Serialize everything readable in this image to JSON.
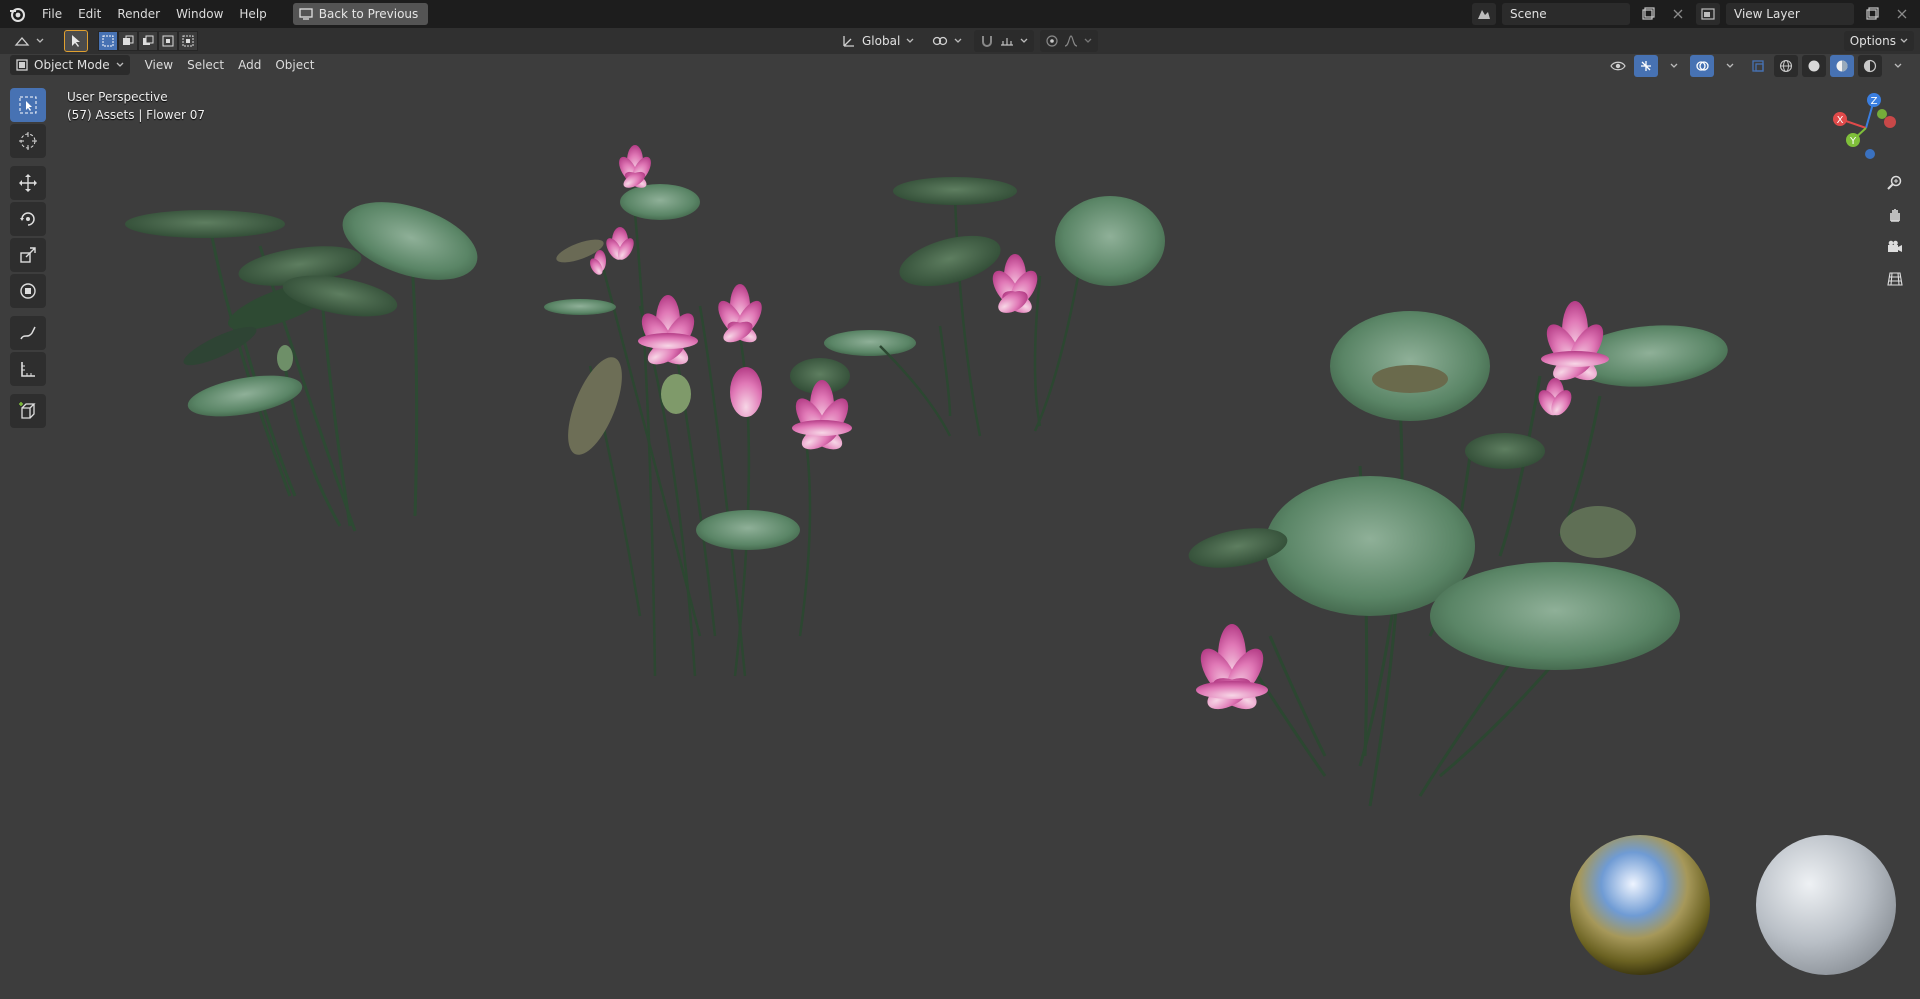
{
  "menubar": {
    "items": [
      "File",
      "Edit",
      "Render",
      "Window",
      "Help"
    ],
    "back_label": "Back to Previous",
    "scene_value": "Scene",
    "view_layer_value": "View Layer"
  },
  "toolheader": {
    "transform_orientation": "Global",
    "options_label": "Options"
  },
  "viewport_header": {
    "mode": "Object Mode",
    "menus": [
      "View",
      "Select",
      "Add",
      "Object"
    ]
  },
  "viewport_info": {
    "perspective": "User Perspective",
    "object": "(57) Assets | Flower 07"
  },
  "gizmo": {
    "axes": [
      "X",
      "Y",
      "Z"
    ],
    "colors": {
      "x": "#e04a4a",
      "y": "#7fbf3a",
      "z": "#3a7ee0"
    }
  },
  "colors": {
    "accent": "#4772b3",
    "lotus_pink": "#d85aa6",
    "leaf_green": "#5f8a6a"
  },
  "icons": {
    "tools": [
      "select-box-icon",
      "cursor-icon",
      "move-icon",
      "rotate-icon",
      "scale-icon",
      "transform-icon",
      "annotate-icon",
      "measure-icon",
      "add-cube-icon"
    ],
    "nav": [
      "zoom-icon",
      "pan-hand-icon",
      "camera-icon",
      "grid-icon"
    ]
  }
}
